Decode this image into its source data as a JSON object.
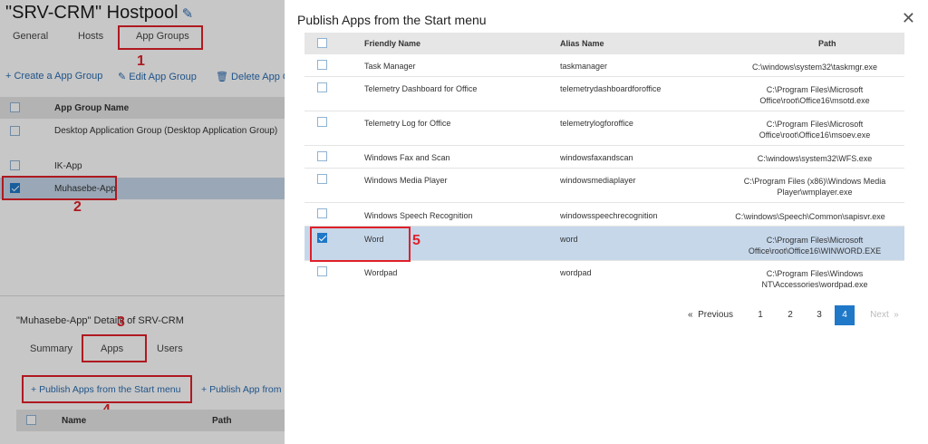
{
  "hostpool": {
    "title": "\"SRV-CRM\" Hostpool"
  },
  "top_tabs": [
    "General",
    "Hosts",
    "App Groups"
  ],
  "toolbar": {
    "create": "Create a App Group",
    "edit": "Edit App Group",
    "delete": "Delete App G"
  },
  "app_group_table": {
    "header": "App Group Name",
    "rows": [
      "Desktop Application Group (Desktop Application Group)",
      "IK-App",
      "Muhasebe-App"
    ]
  },
  "details": {
    "title": "\"Muhasebe-App\" Details of SRV-CRM",
    "tabs": [
      "Summary",
      "Apps",
      "Users"
    ]
  },
  "publish_bar": {
    "start_menu": "Publish Apps from the Start menu",
    "other": "Publish App from"
  },
  "bottom_table": {
    "name": "Name",
    "path": "Path"
  },
  "annotations": [
    "1",
    "2",
    "3",
    "4",
    "5"
  ],
  "modal": {
    "title": "Publish Apps from the Start menu",
    "columns": {
      "friendly": "Friendly Name",
      "alias": "Alias Name",
      "path": "Path"
    },
    "rows": [
      {
        "friendly": "Task Manager",
        "alias": "taskmanager",
        "path": "C:\\windows\\system32\\taskmgr.exe"
      },
      {
        "friendly": "Telemetry Dashboard for Office",
        "alias": "telemetrydashboardforoffice",
        "path": "C:\\Program Files\\Microsoft Office\\root\\Office16\\msotd.exe"
      },
      {
        "friendly": "Telemetry Log for Office",
        "alias": "telemetrylogforoffice",
        "path": "C:\\Program Files\\Microsoft Office\\root\\Office16\\msoev.exe"
      },
      {
        "friendly": "Windows Fax and Scan",
        "alias": "windowsfaxandscan",
        "path": "C:\\windows\\system32\\WFS.exe"
      },
      {
        "friendly": "Windows Media Player",
        "alias": "windowsmediaplayer",
        "path": "C:\\Program Files (x86)\\Windows Media Player\\wmplayer.exe"
      },
      {
        "friendly": "Windows Speech Recognition",
        "alias": "windowsspeechrecognition",
        "path": "C:\\windows\\Speech\\Common\\sapisvr.exe"
      },
      {
        "friendly": "Word",
        "alias": "word",
        "path": "C:\\Program Files\\Microsoft Office\\root\\Office16\\WINWORD.EXE"
      },
      {
        "friendly": "Wordpad",
        "alias": "wordpad",
        "path": "C:\\Program Files\\Windows NT\\Accessories\\wordpad.exe"
      }
    ],
    "pagination": {
      "previous": "Previous",
      "pages": [
        "1",
        "2",
        "3",
        "4"
      ],
      "current": "4",
      "next": "Next"
    }
  },
  "colors": {
    "accent": "#1f78c8",
    "highlight": "#e0202a",
    "selected_row": "#c6d7ea"
  }
}
